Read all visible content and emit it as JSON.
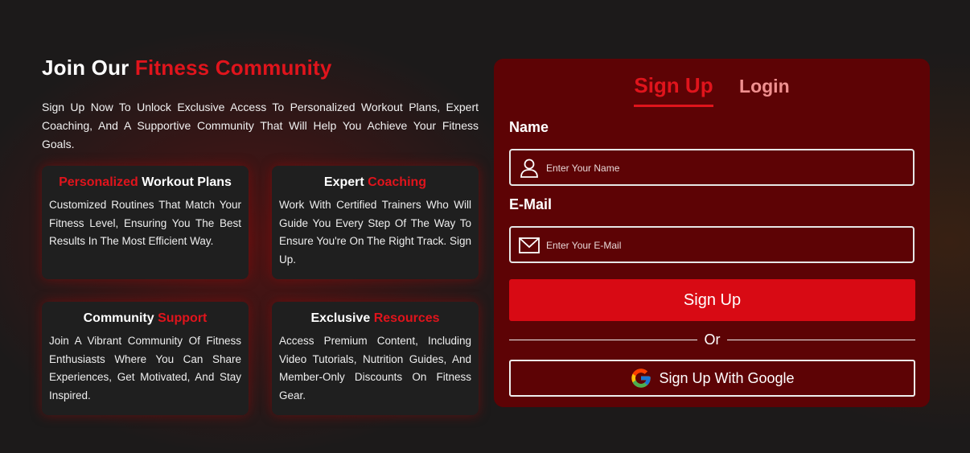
{
  "hero": {
    "title_part1": "Join Our ",
    "title_part2": "Fitness Community",
    "description": "Sign Up Now To Unlock Exclusive Access To Personalized Workout Plans, Expert Coaching, And A Supportive Community That Will Help You Achieve Your Fitness Goals."
  },
  "features": [
    {
      "title_accent": "Personalized",
      "title_plain": " Workout Plans",
      "body": "Customized Routines That Match Your Fitness Level, Ensuring You The Best Results In The Most Efficient Way."
    },
    {
      "title_plain": "Expert ",
      "title_accent": "Coaching",
      "body": "Work With Certified Trainers Who Will Guide You Every Step Of The Way To Ensure You're On The Right Track. Sign Up."
    },
    {
      "title_plain": "Community ",
      "title_accent": "Support",
      "body": "Join A Vibrant Community Of Fitness Enthusiasts Where You Can Share Experiences, Get Motivated, And Stay Inspired."
    },
    {
      "title_plain": "Exclusive ",
      "title_accent": "Resources",
      "body": "Access Premium Content, Including Video Tutorials, Nutrition Guides, And Member-Only Discounts On Fitness Gear."
    }
  ],
  "form": {
    "tab_signup": "Sign Up",
    "tab_login": "Login",
    "name_label": "Name",
    "name_placeholder": "Enter Your Name",
    "email_label": "E-Mail",
    "email_placeholder": "Enter Your E-Mail",
    "submit_label": "Sign Up",
    "divider_text": "Or",
    "google_label": "Sign Up With Google"
  },
  "colors": {
    "accent": "#e0141c",
    "panel": "#5d0305",
    "button": "#d80a14",
    "card": "#1f1f1f"
  },
  "icons": [
    "user-icon",
    "mail-icon",
    "google-icon"
  ]
}
